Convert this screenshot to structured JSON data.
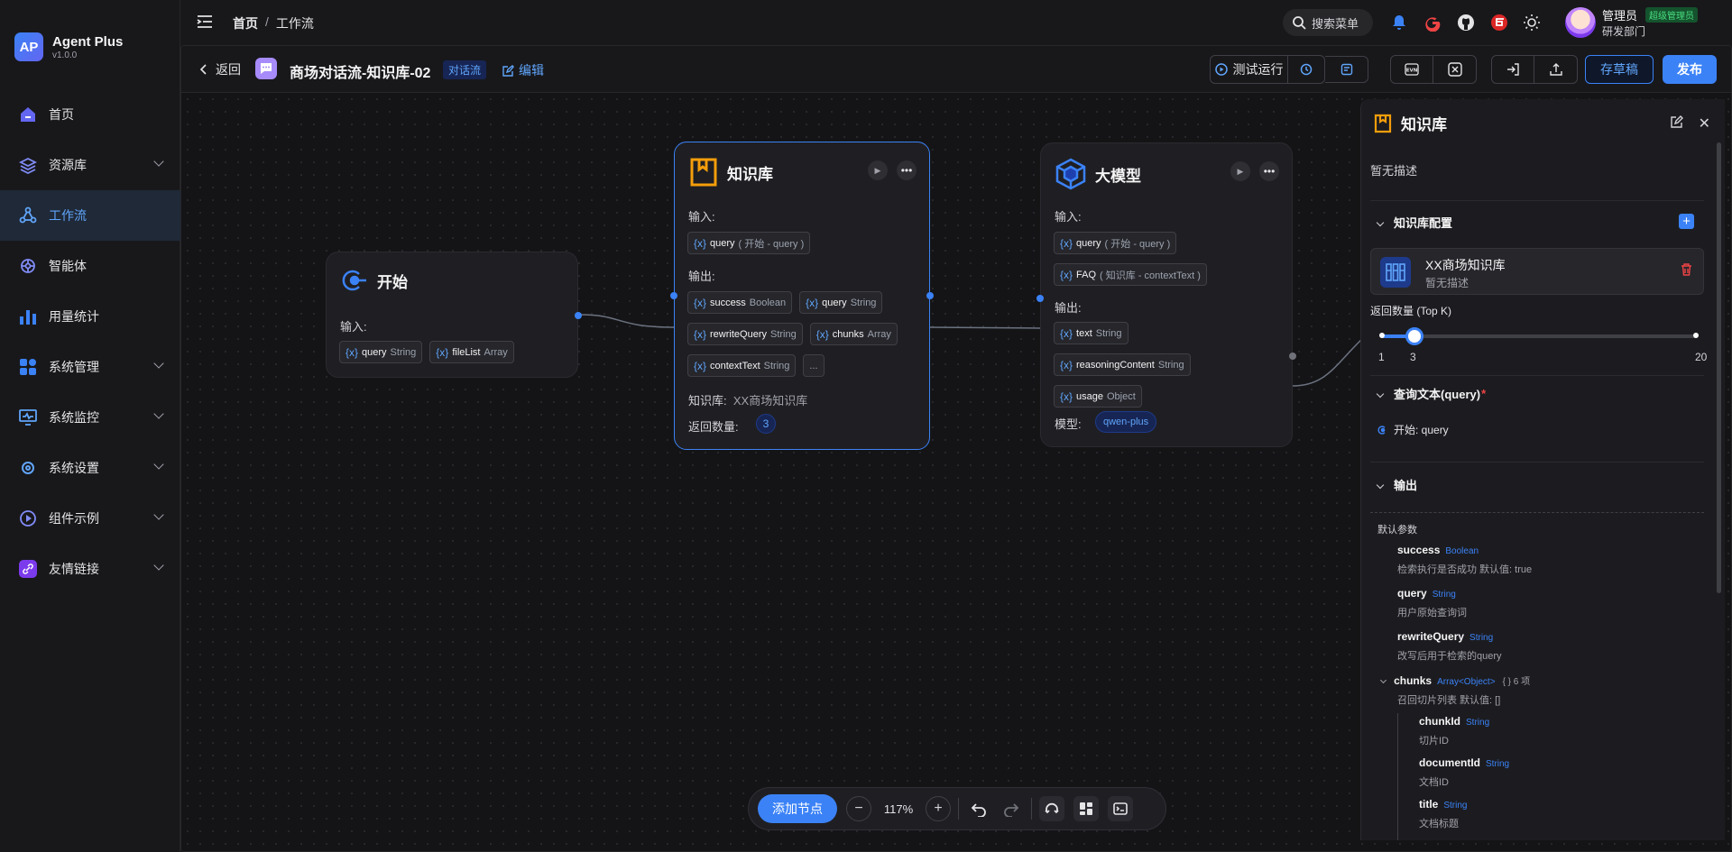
{
  "app": {
    "name": "Agent Plus",
    "version": "v1.0.0",
    "logo_text": "AP"
  },
  "sidebar": {
    "items": [
      {
        "label": "首页",
        "icon": "home-icon",
        "has_children": false
      },
      {
        "label": "资源库",
        "icon": "layers-icon",
        "has_children": true
      },
      {
        "label": "工作流",
        "icon": "workflow-icon",
        "has_children": false,
        "active": true
      },
      {
        "label": "智能体",
        "icon": "agent-icon",
        "has_children": false
      },
      {
        "label": "用量统计",
        "icon": "bar-chart-icon",
        "has_children": false
      },
      {
        "label": "系统管理",
        "icon": "grid-icon",
        "has_children": true
      },
      {
        "label": "系统监控",
        "icon": "monitor-icon",
        "has_children": true
      },
      {
        "label": "系统设置",
        "icon": "settings-icon",
        "has_children": true
      },
      {
        "label": "组件示例",
        "icon": "play-circle-icon",
        "has_children": true
      },
      {
        "label": "友情链接",
        "icon": "link-icon",
        "has_children": true
      }
    ]
  },
  "header": {
    "breadcrumb": [
      "首页",
      "工作流"
    ],
    "breadcrumb_sep": "/",
    "search_label": "搜索菜单",
    "user": {
      "name": "管理员",
      "role": "超级管理员",
      "dept": "研发部门"
    }
  },
  "toolbar": {
    "back_label": "返回",
    "flow_title": "商场对话流-知识库-02",
    "flow_tag": "对话流",
    "edit_label": "编辑",
    "test_run_label": "测试运行",
    "save_label": "存草稿",
    "publish_label": "发布"
  },
  "nodes": {
    "start": {
      "title": "开始",
      "input_label": "输入:",
      "inputs": [
        {
          "name": "query",
          "type": "String"
        },
        {
          "name": "fileList",
          "type": "Array"
        }
      ]
    },
    "kb": {
      "title": "知识库",
      "input_label": "输入:",
      "inputs": [
        {
          "name": "query",
          "type": "( 开始 - query )"
        }
      ],
      "output_label": "输出:",
      "outputs": [
        {
          "name": "success",
          "type": "Boolean"
        },
        {
          "name": "query",
          "type": "String"
        },
        {
          "name": "rewriteQuery",
          "type": "String"
        },
        {
          "name": "chunks",
          "type": "Array"
        },
        {
          "name": "contextText",
          "type": "String"
        }
      ],
      "more": "...",
      "kb_label": "知识库:",
      "kb_value": "XX商场知识库",
      "topk_label": "返回数量:",
      "topk_value": "3"
    },
    "llm": {
      "title": "大模型",
      "input_label": "输入:",
      "inputs": [
        {
          "name": "query",
          "type": "( 开始 - query )"
        },
        {
          "name": "FAQ",
          "type": "( 知识库 - contextText )"
        }
      ],
      "output_label": "输出:",
      "outputs": [
        {
          "name": "text",
          "type": "String"
        },
        {
          "name": "reasoningContent",
          "type": "String"
        },
        {
          "name": "usage",
          "type": "Object"
        }
      ],
      "model_label": "模型:",
      "model_value": "qwen-plus"
    }
  },
  "var_token": "{x}",
  "dock": {
    "add_node_label": "添加节点",
    "zoom": "117%"
  },
  "panel": {
    "title": "知识库",
    "desc": "暂无描述",
    "kb_config_label": "知识库配置",
    "kb_card": {
      "name": "XX商场知识库",
      "desc": "暂无描述"
    },
    "topk_label": "返回数量 (Top K)",
    "topk": {
      "min": "1",
      "value": "3",
      "max": "20",
      "fraction": 0.105
    },
    "query_label": "查询文本(query)",
    "required_mark": "*",
    "query_source": "开始: query",
    "output_label": "输出",
    "default_params_label": "默认参数",
    "outputs": [
      {
        "name": "success",
        "type": "Boolean",
        "desc": "检索执行是否成功   默认值: true"
      },
      {
        "name": "query",
        "type": "String",
        "desc": "用户原始查询词"
      },
      {
        "name": "rewriteQuery",
        "type": "String",
        "desc": "改写后用于检索的query"
      },
      {
        "name": "chunks",
        "type": "Array<Object>",
        "extra": "{ } 6 项",
        "desc": "召回切片列表   默认值: []"
      }
    ],
    "chunk_fields": [
      {
        "name": "chunkId",
        "type": "String",
        "desc": "切片ID"
      },
      {
        "name": "documentId",
        "type": "String",
        "desc": "文档ID"
      },
      {
        "name": "title",
        "type": "String",
        "desc": "文档标题"
      }
    ]
  },
  "colors": {
    "accent": "#3b82f6",
    "bg": "#18181b",
    "kb_icon": "#f59e0b",
    "llm_icon": "#3b82f6"
  }
}
